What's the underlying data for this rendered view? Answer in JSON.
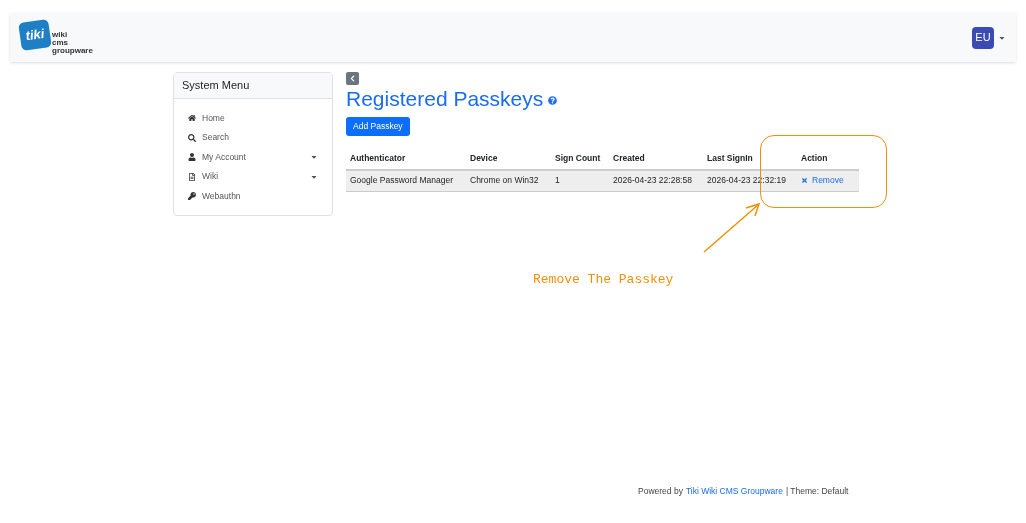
{
  "logo": {
    "mark": "tiki",
    "lines": [
      "wiki",
      "cms",
      "groupware"
    ]
  },
  "user": {
    "initials": "EU"
  },
  "sidebar": {
    "title": "System Menu",
    "items": [
      {
        "label": "Home",
        "has_submenu": false
      },
      {
        "label": "Search",
        "has_submenu": false
      },
      {
        "label": "My Account",
        "has_submenu": true
      },
      {
        "label": "Wiki",
        "has_submenu": true
      },
      {
        "label": "Webauthn",
        "has_submenu": false
      }
    ]
  },
  "page": {
    "title": "Registered Passkeys",
    "add_button": "Add Passkey"
  },
  "table": {
    "columns": [
      "Authenticator",
      "Device",
      "Sign Count",
      "Created",
      "Last SignIn",
      "Action"
    ],
    "rows": [
      {
        "cells": [
          "Google Password Manager",
          "Chrome on Win32",
          "1",
          "2026-04-23 22:28:58",
          "2026-04-23 22:32:19"
        ],
        "action": "Remove"
      }
    ]
  },
  "annotation": {
    "text": "Remove The Passkey"
  },
  "footer": {
    "prefix": "Powered by",
    "link": "Tiki Wiki CMS Groupware",
    "suffix": "| Theme: Default"
  }
}
